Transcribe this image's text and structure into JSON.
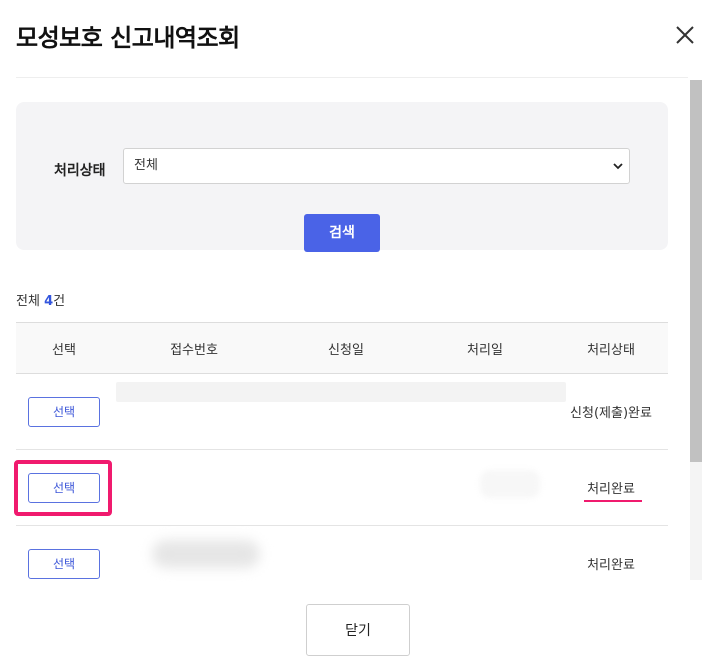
{
  "dialog": {
    "title": "모성보호 신고내역조회",
    "close_icon": "close-icon",
    "close_button_label": "닫기"
  },
  "filter": {
    "status_label": "처리상태",
    "status_value": "전체",
    "search_label": "검색"
  },
  "results": {
    "total_prefix": "전체",
    "total_count": "4",
    "total_suffix": "건",
    "columns": [
      "선택",
      "접수번호",
      "신청일",
      "처리일",
      "처리상태"
    ],
    "rows": [
      {
        "select_label": "선택",
        "receipt_no": "",
        "apply_date": "",
        "process_date": "",
        "status": "신청(제출)완료"
      },
      {
        "select_label": "선택",
        "receipt_no": "",
        "apply_date": "",
        "process_date": "",
        "status": "처리완료"
      },
      {
        "select_label": "선택",
        "receipt_no": "",
        "apply_date": "",
        "process_date": "",
        "status": "처리완료"
      }
    ]
  },
  "colors": {
    "primary": "#4a63e7",
    "highlight": "#f01a6e"
  }
}
